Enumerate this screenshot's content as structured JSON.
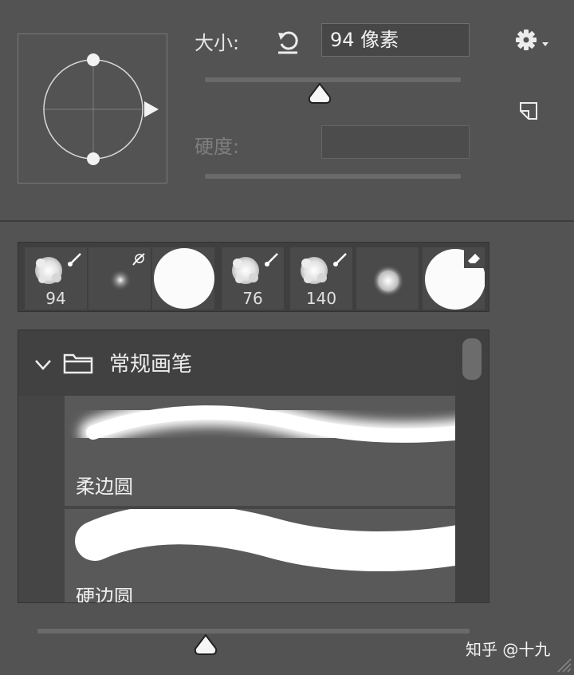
{
  "size": {
    "label": "大小:",
    "value": "94 像素",
    "slider_fraction": 0.45
  },
  "hardness": {
    "label": "硬度:",
    "value": "",
    "disabled": true
  },
  "presets": [
    {
      "kind": "chalk",
      "size": "94",
      "badge": "brush-icon"
    },
    {
      "kind": "soft-airbrush",
      "size": "",
      "badge": "airbrush-icon"
    },
    {
      "kind": "hard-round",
      "size": ""
    },
    {
      "kind": "chalk",
      "size": "76",
      "badge": "brush-icon"
    },
    {
      "kind": "chalk",
      "size": "140",
      "badge": "brush-icon"
    },
    {
      "kind": "soft-round",
      "size": ""
    },
    {
      "kind": "hard-round",
      "size": "",
      "badge": "eraser-icon"
    }
  ],
  "brush_group": {
    "name": "常规画笔",
    "expanded": true
  },
  "brushes": [
    {
      "name": "柔边圆",
      "style": "soft"
    },
    {
      "name": "硬边圆",
      "style": "hard"
    }
  ],
  "preview_size": {
    "slider_fraction": 0.39
  },
  "watermark": "知乎 @十九",
  "colors": {
    "panel": "#535353",
    "field": "#474747",
    "track": "#6a6a6a"
  }
}
